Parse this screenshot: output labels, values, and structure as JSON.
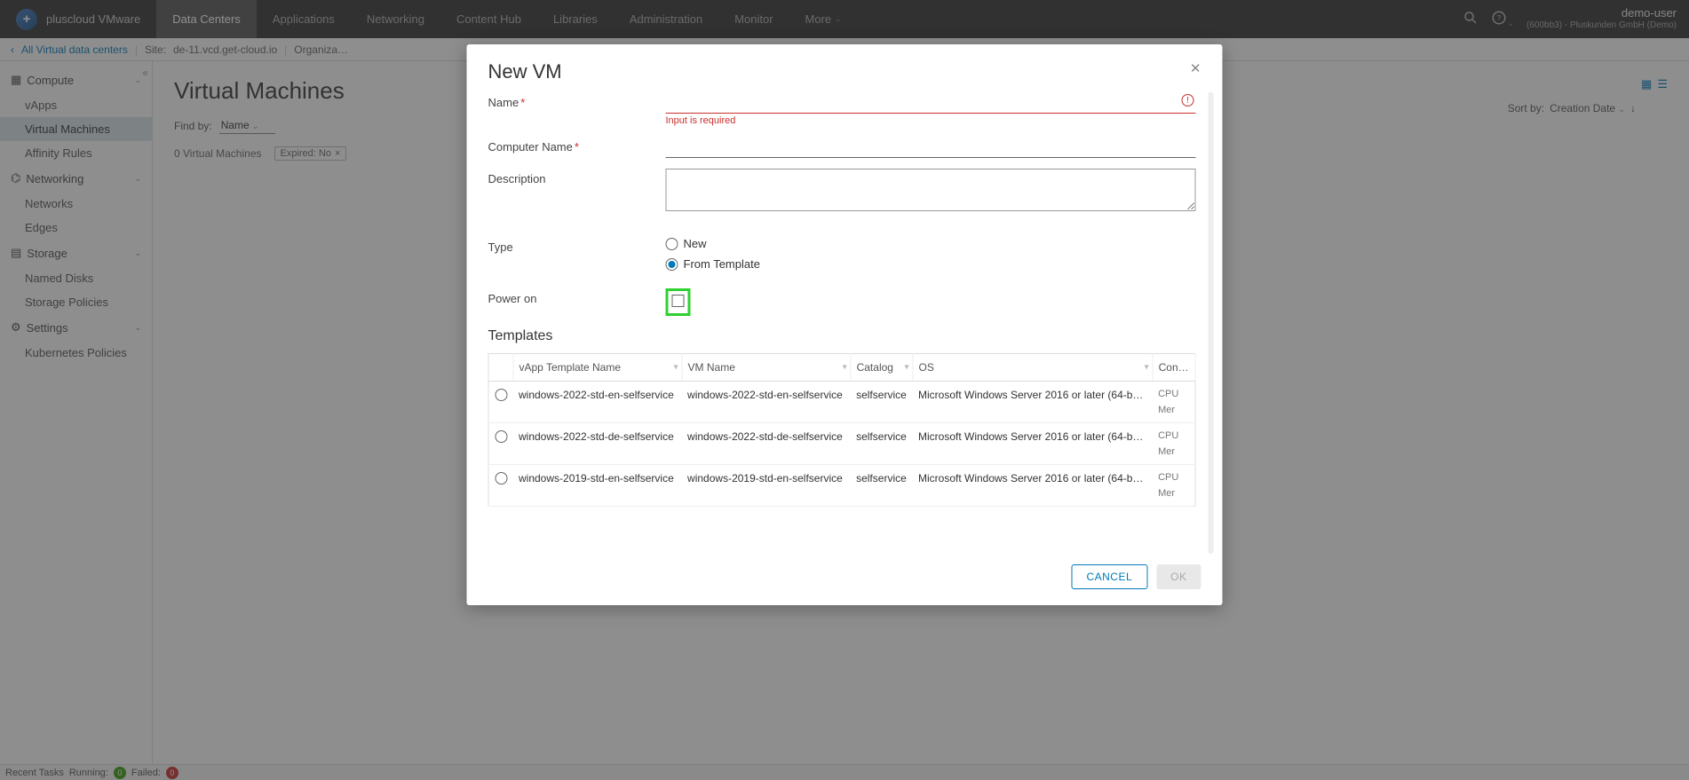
{
  "brand": "pluscloud VMware",
  "nav": [
    "Data Centers",
    "Applications",
    "Networking",
    "Content Hub",
    "Libraries",
    "Administration",
    "Monitor",
    "More"
  ],
  "nav_active_index": 0,
  "user": {
    "name": "demo-user",
    "org": "(600bb3) - Pluskunden GmbH (Demo)"
  },
  "breadcrumb": {
    "back": "All Virtual data centers",
    "site_label": "Site:",
    "site": "de-11.vcd.get-cloud.io",
    "org_label": "Organiza…"
  },
  "sidebar": {
    "groups": [
      {
        "label": "Compute",
        "expanded": true,
        "items": [
          "vApps",
          "Virtual Machines",
          "Affinity Rules"
        ],
        "active_index": 1
      },
      {
        "label": "Networking",
        "expanded": true,
        "items": [
          "Networks",
          "Edges"
        ]
      },
      {
        "label": "Storage",
        "expanded": true,
        "items": [
          "Named Disks",
          "Storage Policies"
        ]
      },
      {
        "label": "Settings",
        "expanded": true,
        "items": [
          "Kubernetes Policies"
        ]
      }
    ]
  },
  "page": {
    "title": "Virtual Machines",
    "find_label": "Find by:",
    "find_field": "Name",
    "count": "0 Virtual Machines",
    "expired_chip": "Expired:  No",
    "sort_label": "Sort by:",
    "sort_field": "Creation Date"
  },
  "footer": {
    "label": "Recent Tasks",
    "running": "Running:",
    "running_n": "0",
    "failed": "Failed:",
    "failed_n": "0"
  },
  "modal": {
    "title": "New VM",
    "fields": {
      "name": "Name",
      "name_err": "Input is required",
      "computer_name": "Computer Name",
      "description": "Description",
      "type": "Type",
      "type_new": "New",
      "type_template": "From Template",
      "power_on": "Power on",
      "templates_title": "Templates"
    },
    "table": {
      "cols": [
        "vApp Template Name",
        "VM Name",
        "Catalog",
        "OS",
        "Con…"
      ],
      "rows": [
        {
          "tpl": "windows-2022-std-en-selfservice",
          "vm": "windows-2022-std-en-selfservice",
          "cat": "selfservice",
          "os": "Microsoft Windows Server 2016 or later (64-b…",
          "cpu": "CPU",
          "mem": "Mer"
        },
        {
          "tpl": "windows-2022-std-de-selfservice",
          "vm": "windows-2022-std-de-selfservice",
          "cat": "selfservice",
          "os": "Microsoft Windows Server 2016 or later (64-b…",
          "cpu": "CPU",
          "mem": "Mer"
        },
        {
          "tpl": "windows-2019-std-en-selfservice",
          "vm": "windows-2019-std-en-selfservice",
          "cat": "selfservice",
          "os": "Microsoft Windows Server 2016 or later (64-b…",
          "cpu": "CPU",
          "mem": "Mer"
        }
      ]
    },
    "buttons": {
      "cancel": "CANCEL",
      "ok": "OK"
    }
  }
}
